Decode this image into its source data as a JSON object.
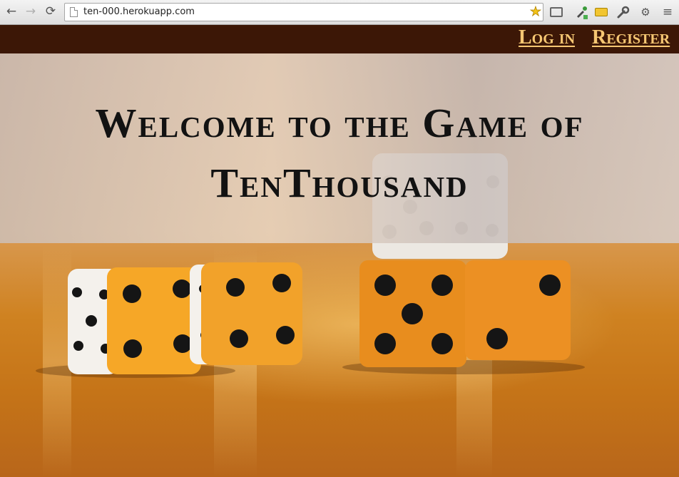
{
  "browser": {
    "url": "ten-000.herokuapp.com",
    "back_icon": "←",
    "forward_icon": "→",
    "reload_icon": "⟳",
    "star_icon": "★",
    "menu_icon": "≡",
    "settings_icon": "⚙",
    "wrench_icon": "🔧"
  },
  "nav": {
    "login": "Log in",
    "register": "Register"
  },
  "hero": {
    "title": "Welcome to the Game of TenThousand"
  },
  "colors": {
    "nav_bg": "#3c1706",
    "nav_link": "#f6c773",
    "title": "#121212"
  }
}
